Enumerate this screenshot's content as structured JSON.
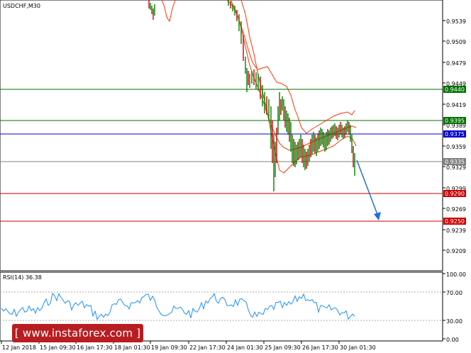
{
  "chart": {
    "symbol_label": "USDCHF,M30",
    "price_ticks": [
      "0.9539",
      "0.9509",
      "0.9479",
      "0.9449",
      "0.9419",
      "0.9389",
      "0.9359",
      "0.9329",
      "0.9299",
      "0.9269",
      "0.9239",
      "0.9209"
    ],
    "time_ticks": [
      "12 Jan 2018",
      "15 Jan 09:30",
      "16 Jan 17:30",
      "18 Jan 01:30",
      "19 Jan 09:30",
      "22 Jan 17:30",
      "24 Jan 01:30",
      "25 Jan 09:30",
      "26 Jan 17:30",
      "30 Jan 01:30"
    ],
    "levels": [
      {
        "value": "0.9440",
        "color": "#007000"
      },
      {
        "value": "0.9395",
        "color": "#007000"
      },
      {
        "value": "0.9375",
        "color": "#0000cc"
      },
      {
        "value": "0.9335",
        "color": "#808080"
      },
      {
        "value": "0.9290",
        "color": "#cc0000"
      },
      {
        "value": "0.9250",
        "color": "#cc0000"
      }
    ],
    "colors": {
      "bull_candle": "#008000",
      "bear_candle": "#cc0000",
      "bollinger": "#ff3300",
      "arrow": "#1f6fe0",
      "rsi_line": "#1e90ff"
    }
  },
  "rsi": {
    "label": "RSI(14) 36.38",
    "ticks": [
      "100.00",
      "70.00",
      "30.00",
      "0.00"
    ]
  },
  "watermark": {
    "text": "[ www.instaforex.com ]"
  }
}
